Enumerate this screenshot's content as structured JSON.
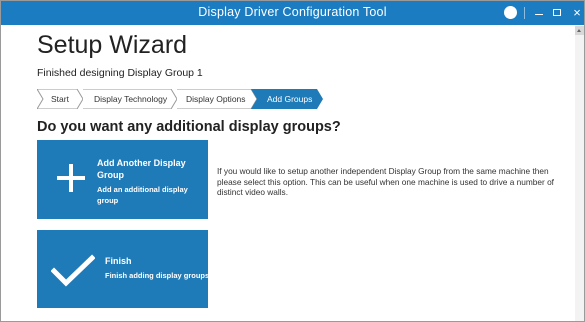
{
  "window": {
    "title": "Display Driver Configuration Tool",
    "info_glyph": "i",
    "close_glyph": "×"
  },
  "page": {
    "heading": "Setup Wizard",
    "subtitle": "Finished designing Display Group 1",
    "question": "Do you want any additional display groups?"
  },
  "breadcrumb": [
    {
      "label": "Start",
      "active": false
    },
    {
      "label": "Display Technology",
      "active": false
    },
    {
      "label": "Display Options",
      "active": false
    },
    {
      "label": "Add Groups",
      "active": true
    }
  ],
  "options": {
    "add": {
      "title": "Add Another Display Group",
      "description": "Add an additional display group",
      "icon": "plus-icon"
    },
    "finish": {
      "title": "Finish",
      "description": "Finish adding display groups",
      "icon": "checkmark-icon"
    }
  },
  "help_text": "If you would like to setup another independent Display Group from the same machine then please select this option. This can be useful when one machine is used to drive a number of distinct video walls.",
  "colors": {
    "titlebar": "#1b7cc1",
    "tile": "#1f7ab8",
    "crumb_active": "#1f7ab8"
  }
}
